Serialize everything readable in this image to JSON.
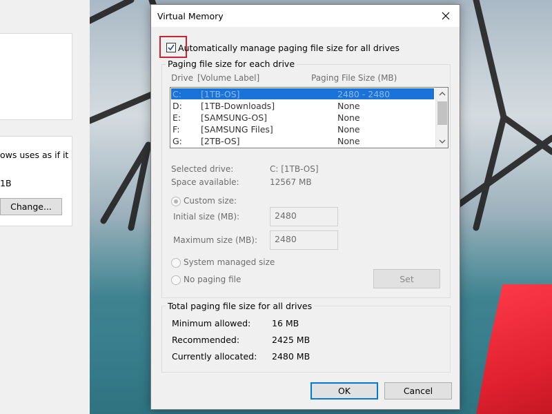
{
  "colors": {
    "accent": "#0078d7",
    "selection": "#1a73d9",
    "highlight_box": "#d1202e"
  },
  "background_window": {
    "text_line_1": "ows uses as if it",
    "text_line_2": "1B",
    "change_button": "Change..."
  },
  "dialog": {
    "title": "Virtual Memory",
    "close_icon": "close-icon",
    "auto_manage": {
      "label": "Automatically manage paging file size for all drives",
      "checked": true
    },
    "paging_group": {
      "legend": "Paging file size for each drive",
      "col_drive": "Drive",
      "col_volume": "[Volume Label]",
      "col_size": "Paging File Size (MB)",
      "drives": [
        {
          "drive": "C:",
          "label": "[1TB-OS]",
          "size": "2480 - 2480",
          "selected": true
        },
        {
          "drive": "D:",
          "label": "[1TB-Downloads]",
          "size": "None",
          "selected": false
        },
        {
          "drive": "E:",
          "label": "[SAMSUNG-OS]",
          "size": "None",
          "selected": false
        },
        {
          "drive": "F:",
          "label": "[SAMSUNG Files]",
          "size": "None",
          "selected": false
        },
        {
          "drive": "G:",
          "label": "[2TB-OS]",
          "size": "None",
          "selected": false
        }
      ],
      "selected_drive_label": "Selected drive:",
      "selected_drive_value": "C:  [1TB-OS]",
      "space_available_label": "Space available:",
      "space_available_value": "12567 MB",
      "custom_size_label": "Custom size:",
      "initial_size_label": "Initial size (MB):",
      "initial_size_value": "2480",
      "maximum_size_label": "Maximum size (MB):",
      "maximum_size_value": "2480",
      "system_managed_label": "System managed size",
      "no_paging_label": "No paging file",
      "set_button": "Set",
      "selected_option": "custom"
    },
    "totals_group": {
      "legend": "Total paging file size for all drives",
      "minimum_label": "Minimum allowed:",
      "minimum_value": "16 MB",
      "recommended_label": "Recommended:",
      "recommended_value": "2425 MB",
      "allocated_label": "Currently allocated:",
      "allocated_value": "2480 MB"
    },
    "ok_button": "OK",
    "cancel_button": "Cancel"
  }
}
